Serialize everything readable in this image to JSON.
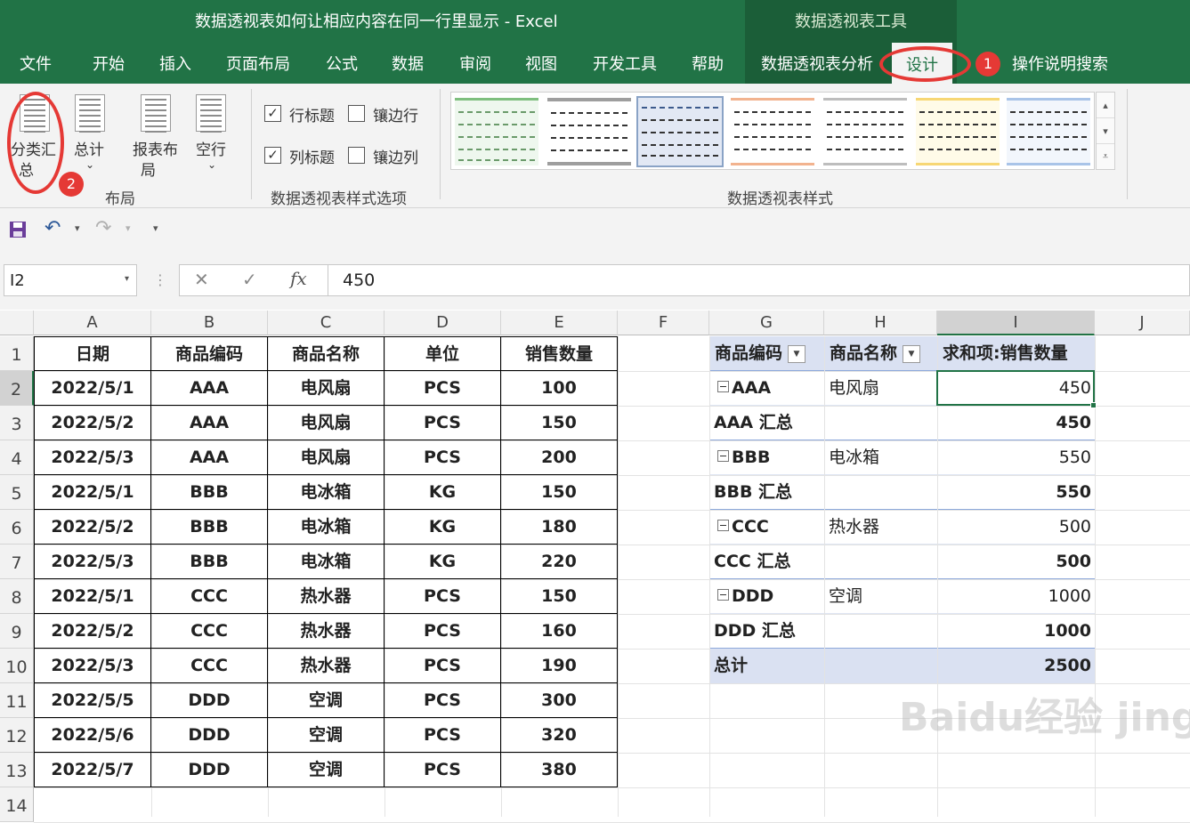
{
  "window": {
    "title": "数据透视表如何让相应内容在同一行里显示  -  Excel",
    "context_tools": "数据透视表工具"
  },
  "tabs": [
    "文件",
    "开始",
    "插入",
    "页面布局",
    "公式",
    "数据",
    "审阅",
    "视图",
    "开发工具",
    "帮助",
    "数据透视表分析",
    "设计",
    "操作说明搜索"
  ],
  "active_tab": "设计",
  "badges": {
    "one": "1",
    "two": "2"
  },
  "ribbon": {
    "layout": {
      "subtotal": "分类汇",
      "subtotal2": "总",
      "grandtotal": "总计",
      "report_layout": "报表布",
      "report_layout2": "局",
      "blank_rows": "空行",
      "group_label": "布局"
    },
    "options": {
      "row_headers": "行标题",
      "banded_rows": "镶边行",
      "col_headers": "列标题",
      "banded_cols": "镶边列",
      "group_label": "数据透视表样式选项",
      "row_headers_checked": true,
      "banded_rows_checked": false,
      "col_headers_checked": true,
      "banded_cols_checked": false
    },
    "styles": {
      "group_label": "数据透视表样式"
    }
  },
  "formula_bar": {
    "name_box": "I2",
    "value": "450",
    "fx": "fx"
  },
  "columns": [
    "A",
    "B",
    "C",
    "D",
    "E",
    "F",
    "G",
    "H",
    "I",
    "J"
  ],
  "rows": [
    "1",
    "2",
    "3",
    "4",
    "5",
    "6",
    "7",
    "8",
    "9",
    "10",
    "11",
    "12",
    "13",
    "14"
  ],
  "source_table": {
    "headers": [
      "日期",
      "商品编码",
      "商品名称",
      "单位",
      "销售数量"
    ],
    "rows": [
      [
        "2022/5/1",
        "AAA",
        "电风扇",
        "PCS",
        "100"
      ],
      [
        "2022/5/2",
        "AAA",
        "电风扇",
        "PCS",
        "150"
      ],
      [
        "2022/5/3",
        "AAA",
        "电风扇",
        "PCS",
        "200"
      ],
      [
        "2022/5/1",
        "BBB",
        "电冰箱",
        "KG",
        "150"
      ],
      [
        "2022/5/2",
        "BBB",
        "电冰箱",
        "KG",
        "180"
      ],
      [
        "2022/5/3",
        "BBB",
        "电冰箱",
        "KG",
        "220"
      ],
      [
        "2022/5/1",
        "CCC",
        "热水器",
        "PCS",
        "150"
      ],
      [
        "2022/5/2",
        "CCC",
        "热水器",
        "PCS",
        "160"
      ],
      [
        "2022/5/3",
        "CCC",
        "热水器",
        "PCS",
        "190"
      ],
      [
        "2022/5/5",
        "DDD",
        "空调",
        "PCS",
        "300"
      ],
      [
        "2022/5/6",
        "DDD",
        "空调",
        "PCS",
        "320"
      ],
      [
        "2022/5/7",
        "DDD",
        "空调",
        "PCS",
        "380"
      ]
    ]
  },
  "pivot": {
    "headers": [
      "商品编码",
      "商品名称",
      "求和项:销售数量"
    ],
    "rows": [
      {
        "code": "AAA",
        "name": "电风扇",
        "value": "450"
      },
      {
        "code": "AAA 汇总",
        "name": "",
        "value": "450"
      },
      {
        "code": "BBB",
        "name": "电冰箱",
        "value": "550"
      },
      {
        "code": "BBB 汇总",
        "name": "",
        "value": "550"
      },
      {
        "code": "CCC",
        "name": "热水器",
        "value": "500"
      },
      {
        "code": "CCC 汇总",
        "name": "",
        "value": "500"
      },
      {
        "code": "DDD",
        "name": "空调",
        "value": "1000"
      },
      {
        "code": "DDD 汇总",
        "name": "",
        "value": "1000"
      },
      {
        "code": "总计",
        "name": "",
        "value": "2500"
      }
    ]
  },
  "watermark": "Baidu经验 jingyan.baidu.com",
  "colors": {
    "excel_green": "#217346",
    "annotation_red": "#e53935",
    "pivot_header_fill": "#dae1f2"
  }
}
